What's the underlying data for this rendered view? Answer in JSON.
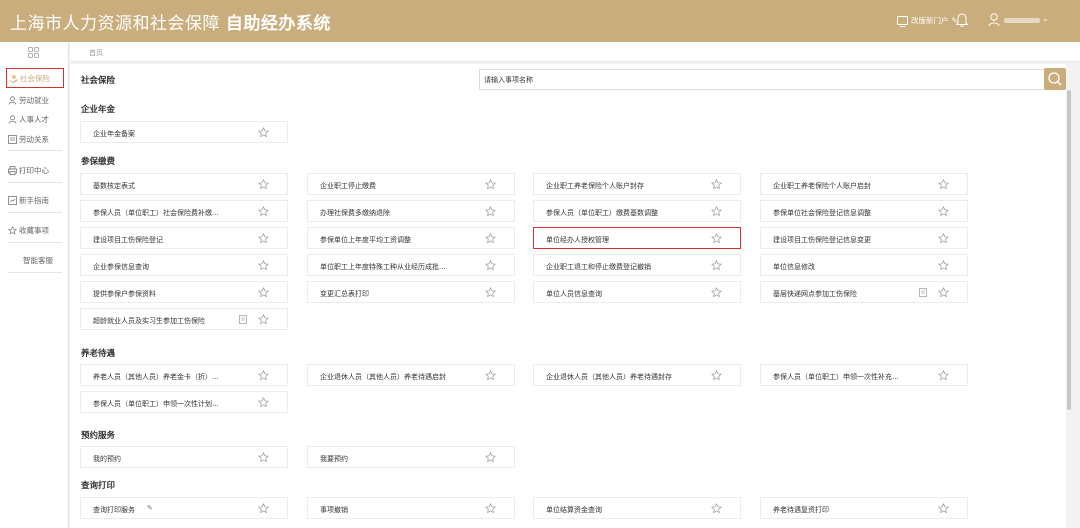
{
  "header": {
    "title_main": "上海市人力资源和社会保障",
    "title_bold": "自助经办系统",
    "portal_label": "改版新门户",
    "portal_edit_icon": "pencil-icon",
    "notify_icon": "bell-icon",
    "user_icon": "user-icon"
  },
  "sidebar": {
    "grid_icon": "grid-icon",
    "items": [
      {
        "label": "社会保险",
        "icon": "social-insurance-icon",
        "active": true
      },
      {
        "label": "劳动就业",
        "icon": "employment-icon"
      },
      {
        "label": "人事人才",
        "icon": "personnel-icon"
      },
      {
        "label": "劳动关系",
        "icon": "labor-relations-icon"
      },
      {
        "label": "打印中心",
        "icon": "printer-icon"
      },
      {
        "label": "新手指南",
        "icon": "guide-icon"
      },
      {
        "label": "收藏事项",
        "icon": "star-icon"
      },
      {
        "label": "智能客服",
        "icon": ""
      }
    ]
  },
  "breadcrumb": {
    "home": "首页"
  },
  "page": {
    "title": "社会保险",
    "search_placeholder": "请输入事项名称",
    "search_icon": "search-icon"
  },
  "sections": [
    {
      "title": "企业年金",
      "items": [
        "企业年金备案"
      ]
    },
    {
      "title": "参保缴费",
      "items": [
        "基数核定表式",
        "企业职工停止缴费",
        "企业职工养老保险个人账户封存",
        "企业职工养老保险个人账户启封",
        "参保人员（单位职工）社会保险费补缴...",
        "办理社保费多缴纳退除",
        "参保人员（单位职工）缴费基数调整",
        "参保单位社会保险登记信息调整",
        "建设项目工伤保险登记",
        "参保单位上年度平均工资调整",
        "单位经办人授权管理",
        "建设项目工伤保险登记信息变更",
        "企业参保信息查询",
        "单位职工上年度特殊工种从业经历成批...",
        "企业职工退工和停止缴费登记撤销",
        "单位信息修改",
        "提供参保户参保资料",
        "变更汇总表打印",
        "单位人员信息查询",
        "基层快递网点参加工伤保险",
        "超龄就业人员及实习生参加工伤保险"
      ]
    },
    {
      "title": "养老待遇",
      "items": [
        "养老人员（其他人员）养老金卡（折）...",
        "企业退休人员（其他人员）养老待遇启封",
        "企业退休人员（其他人员）养老待遇封存",
        "参保人员（单位职工）申领一次性补充...",
        "参保人员（单位职工）申领一次性计划..."
      ]
    },
    {
      "title": "预约服务",
      "items": [
        "我的预约",
        "我要预约"
      ]
    },
    {
      "title": "查询打印",
      "items": [
        "查询打印服务",
        "事项撤销",
        "单位结算资金查询",
        "养老待遇复资打印"
      ]
    }
  ],
  "colors": {
    "brand": "#c9ad7d",
    "highlight": "#d9302f"
  }
}
